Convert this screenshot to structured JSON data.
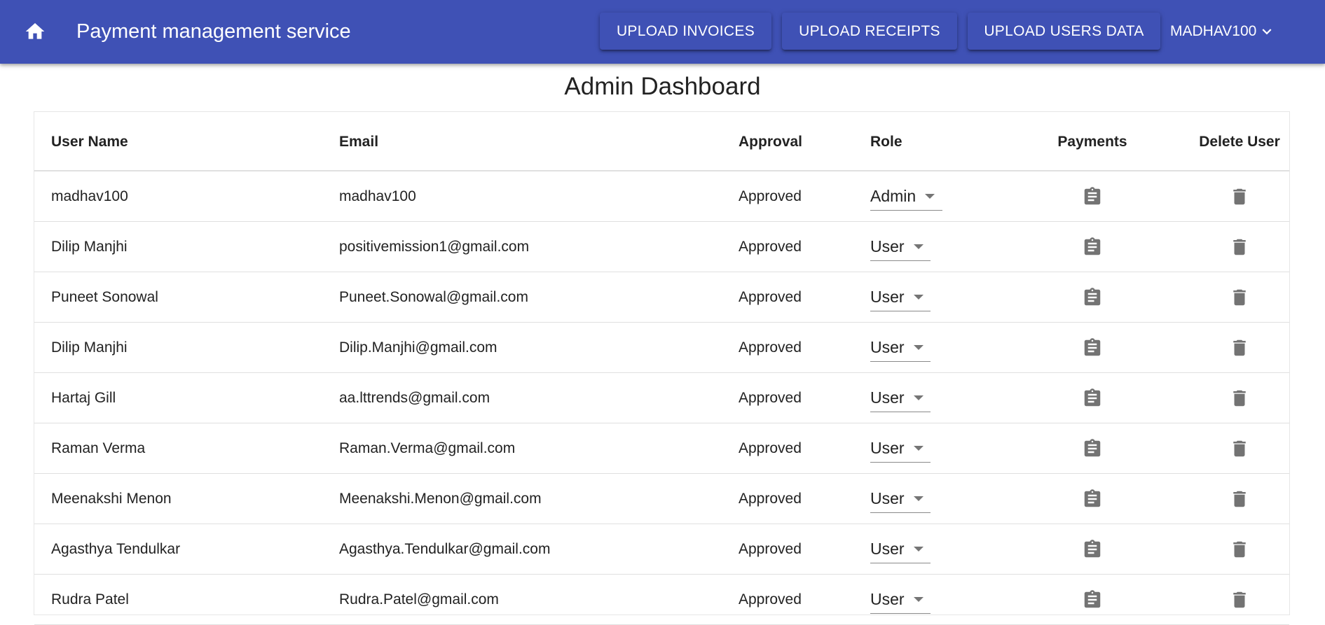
{
  "header": {
    "title": "Payment management service",
    "home_icon": "home-icon",
    "buttons": {
      "upload_invoices": "UPLOAD INVOICES",
      "upload_receipts": "UPLOAD RECEIPTS",
      "upload_users_data": "UPLOAD USERS DATA"
    },
    "user_menu": {
      "label": "MADHAV100",
      "icon": "chevron-down-icon"
    },
    "color": "#3f51b5"
  },
  "page_title": "Admin Dashboard",
  "table": {
    "columns": {
      "user_name": "User Name",
      "email": "Email",
      "approval": "Approval",
      "role": "Role",
      "payments": "Payments",
      "delete_user": "Delete User"
    },
    "payments_icon": "clipboard-icon",
    "delete_icon": "trash-icon",
    "rows": [
      {
        "user_name": "madhav100",
        "email": "madhav100",
        "approval": "Approved",
        "role": "Admin"
      },
      {
        "user_name": "Dilip Manjhi",
        "email": "positivemission1@gmail.com",
        "approval": "Approved",
        "role": "User"
      },
      {
        "user_name": "Puneet Sonowal",
        "email": "Puneet.Sonowal@gmail.com",
        "approval": "Approved",
        "role": "User"
      },
      {
        "user_name": "Dilip Manjhi",
        "email": "Dilip.Manjhi@gmail.com",
        "approval": "Approved",
        "role": "User"
      },
      {
        "user_name": "Hartaj Gill",
        "email": "aa.lttrends@gmail.com",
        "approval": "Approved",
        "role": "User"
      },
      {
        "user_name": "Raman Verma",
        "email": "Raman.Verma@gmail.com",
        "approval": "Approved",
        "role": "User"
      },
      {
        "user_name": "Meenakshi Menon",
        "email": "Meenakshi.Menon@gmail.com",
        "approval": "Approved",
        "role": "User"
      },
      {
        "user_name": "Agasthya Tendulkar",
        "email": "Agasthya.Tendulkar@gmail.com",
        "approval": "Approved",
        "role": "User"
      },
      {
        "user_name": "Rudra Patel",
        "email": "Rudra.Patel@gmail.com",
        "approval": "Approved",
        "role": "User"
      }
    ]
  }
}
